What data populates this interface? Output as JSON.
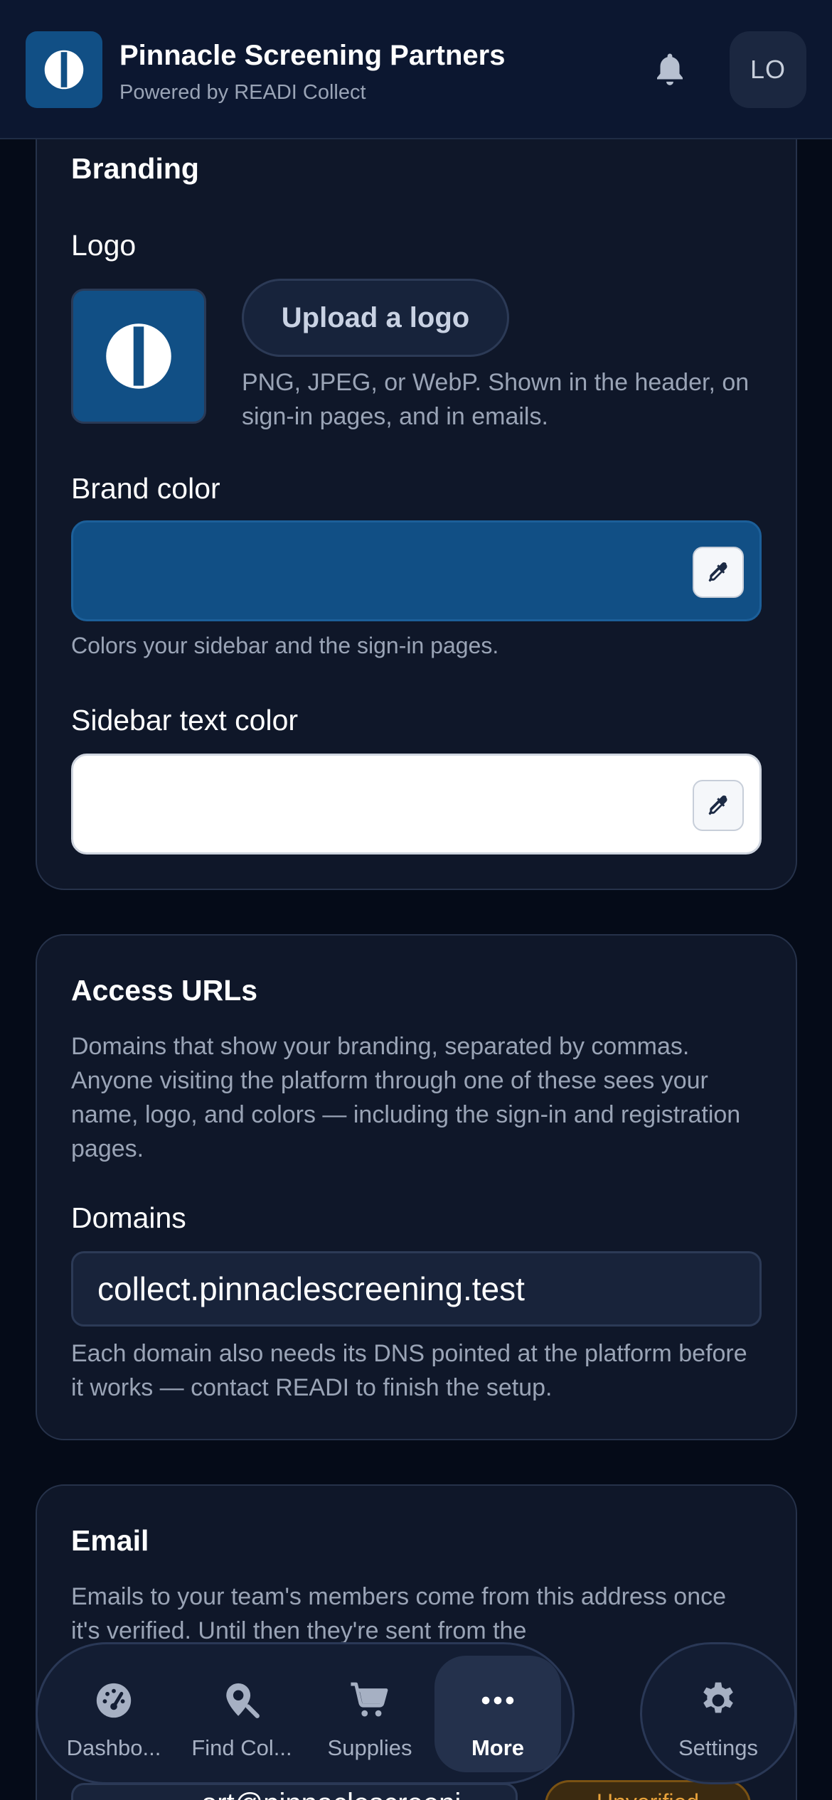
{
  "header": {
    "title": "Pinnacle Screening Partners",
    "subtitle": "Powered by READI Collect",
    "avatar_initials": "LO",
    "brand_color": "#114f85"
  },
  "branding": {
    "section_title": "Branding",
    "logo_label": "Logo",
    "upload_button": "Upload a logo",
    "upload_help": "PNG, JPEG, or WebP. Shown in the header, on sign-in pages, and in emails.",
    "brand_color_label": "Brand color",
    "brand_color_value": "#114f85",
    "brand_color_help": "Colors your sidebar and the sign-in pages.",
    "sidebar_text_color_label": "Sidebar text color",
    "sidebar_text_color_value": "#ffffff"
  },
  "access_urls": {
    "section_title": "Access URLs",
    "description": "Domains that show your branding, separated by commas. Anyone visiting the platform through one of these sees your name, logo, and colors — including the sign-in and registration pages.",
    "domains_label": "Domains",
    "domains_value": "collect.pinnaclescreening.test",
    "domains_help": "Each domain also needs its DNS pointed at the platform before it works — contact READI to finish the setup."
  },
  "email": {
    "section_title": "Email",
    "description": "Emails to your team's members come from this address once it's verified. Until then they're sent from the",
    "address_partial": "ort@pinnaclescreeni",
    "status_badge": "Unverified"
  },
  "bottom_nav": {
    "items": [
      {
        "label": "Dashbo...",
        "icon": "dashboard-gauge-icon"
      },
      {
        "label": "Find Col...",
        "icon": "map-search-icon"
      },
      {
        "label": "Supplies",
        "icon": "cart-icon"
      },
      {
        "label": "More",
        "icon": "more-dots-icon",
        "active": true
      }
    ],
    "settings_label": "Settings"
  }
}
